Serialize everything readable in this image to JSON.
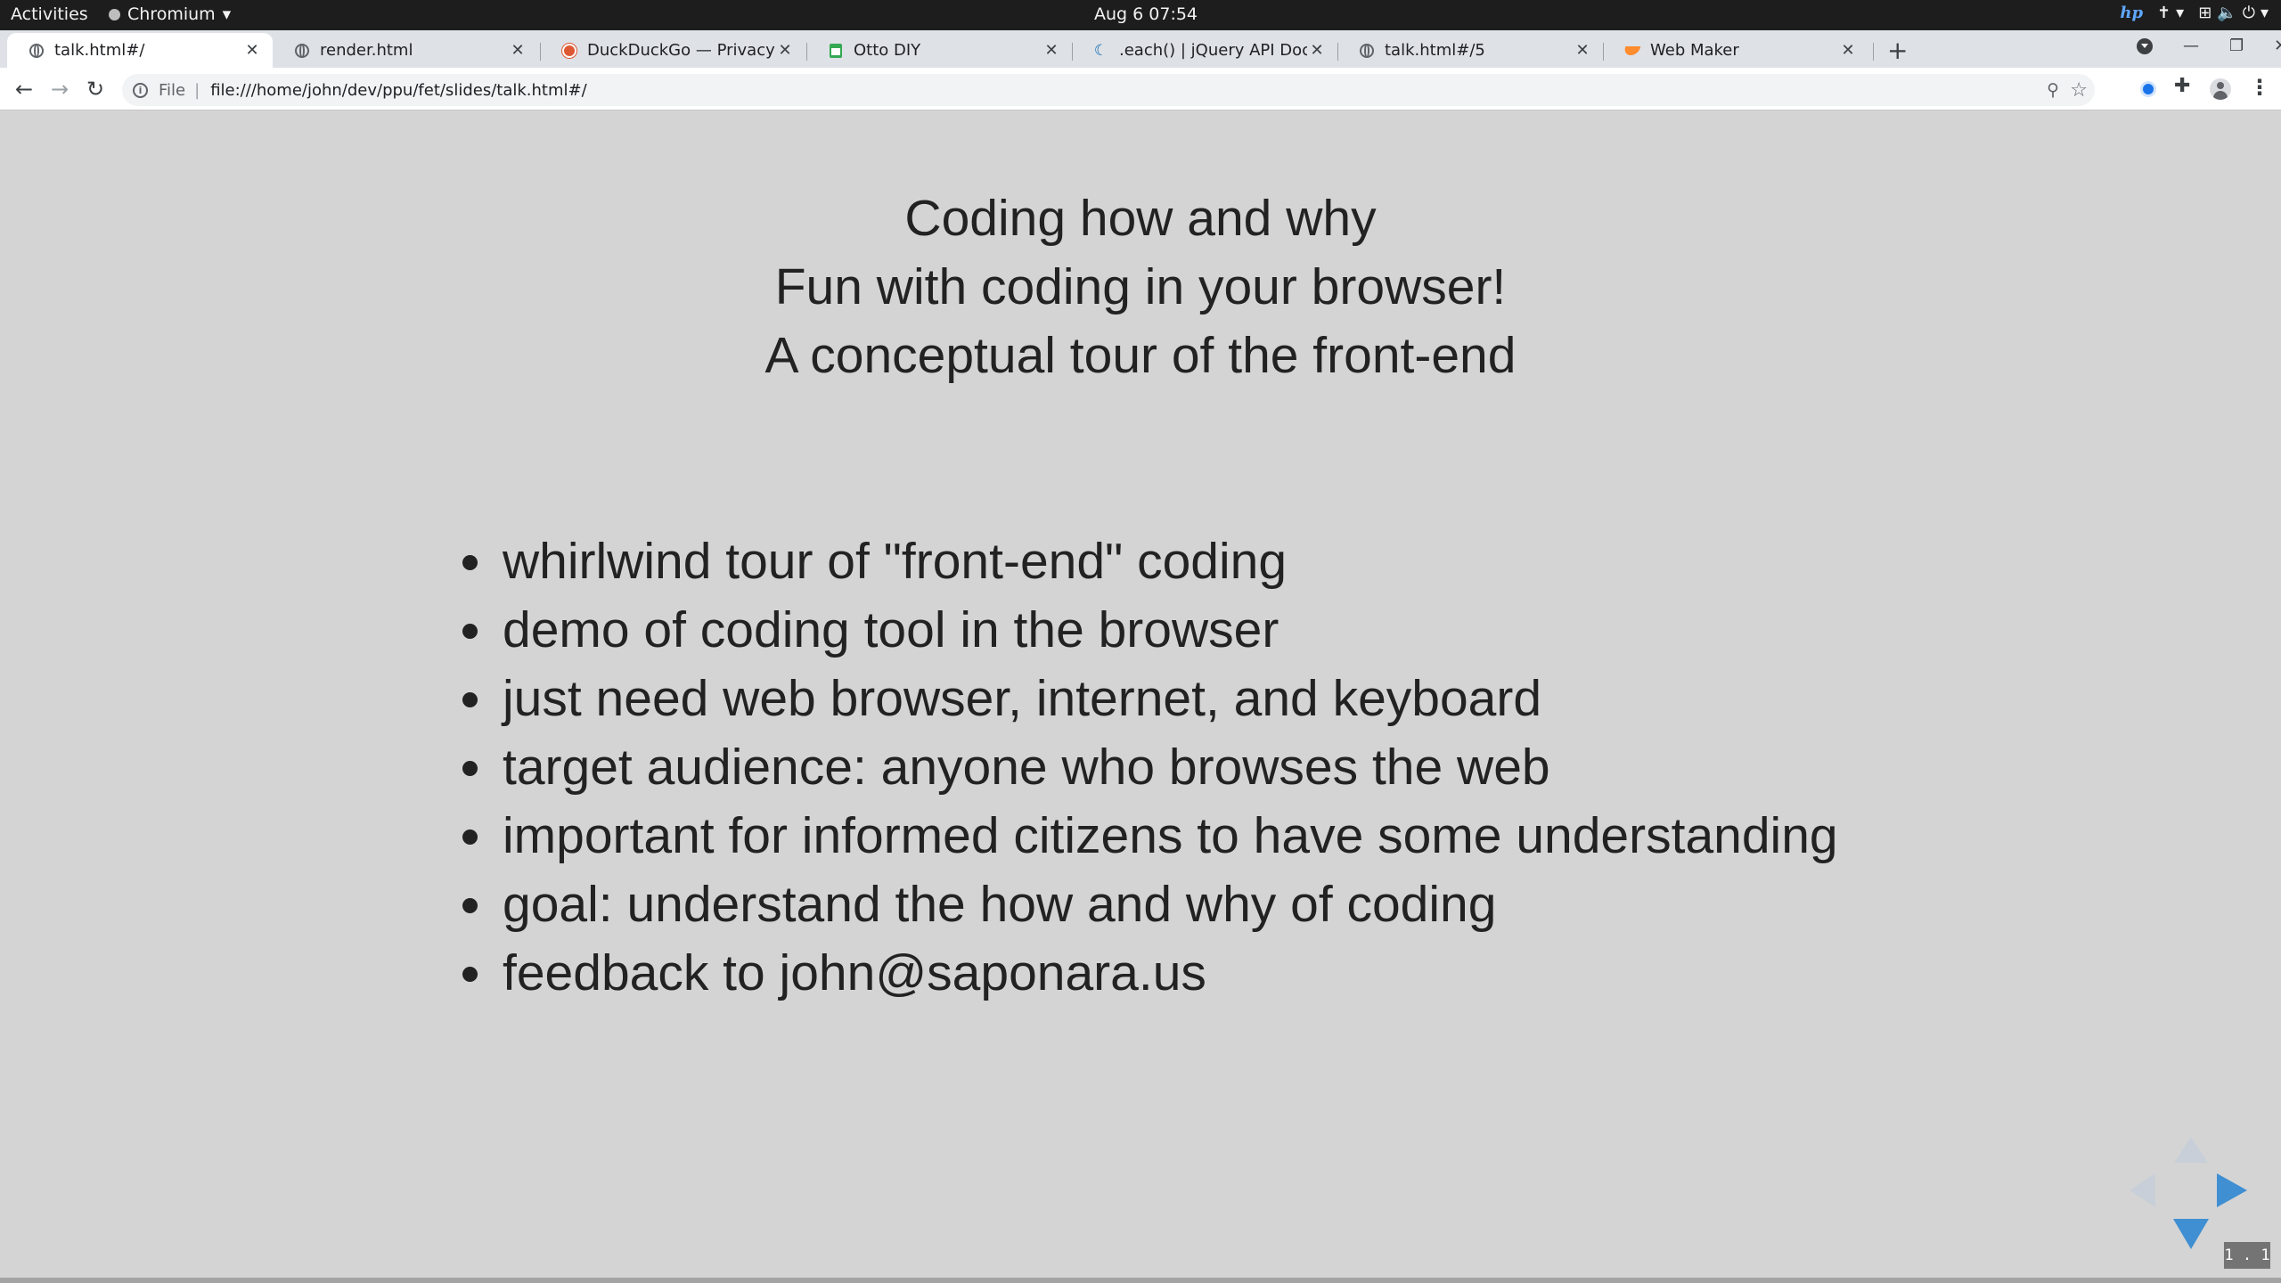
{
  "topbar": {
    "activities": "Activities",
    "app_name": "Chromium",
    "clock": "Aug 6  07:54"
  },
  "tabs": [
    {
      "title": "talk.html#/",
      "favicon": "globe-icon",
      "active": true
    },
    {
      "title": "render.html",
      "favicon": "globe-icon",
      "active": false
    },
    {
      "title": "DuckDuckGo — Privacy, simplified.",
      "favicon": "duckduckgo-icon",
      "active": false
    },
    {
      "title": "Otto DIY",
      "favicon": "otto-icon",
      "active": false
    },
    {
      "title": ".each() | jQuery API Documentation",
      "favicon": "jquery-icon",
      "active": false
    },
    {
      "title": "talk.html#/5",
      "favicon": "globe-icon",
      "active": false
    },
    {
      "title": "Web Maker",
      "favicon": "webmaker-icon",
      "active": false
    }
  ],
  "address_bar": {
    "scheme_label": "File",
    "url": "file:///home/john/dev/ppu/fet/slides/talk.html#/"
  },
  "slide": {
    "headings": [
      "Coding how and why",
      "Fun with coding in your browser!",
      "A conceptual tour of the front-end"
    ],
    "bullets": [
      "whirlwind tour of \"front-end\" coding",
      "demo of coding tool in the browser",
      "just need web browser, internet, and keyboard",
      "target audience: anyone who browses the web",
      "important for informed citizens to have some understanding",
      "goal: understand the how and why of coding",
      "feedback to john@saponara.us"
    ],
    "slide_number": "1 . 1"
  },
  "colors": {
    "slide_background": "#d4d4d4",
    "text": "#222222",
    "control_active": "#3f8fd2",
    "control_inactive": "#c8cfd8"
  }
}
